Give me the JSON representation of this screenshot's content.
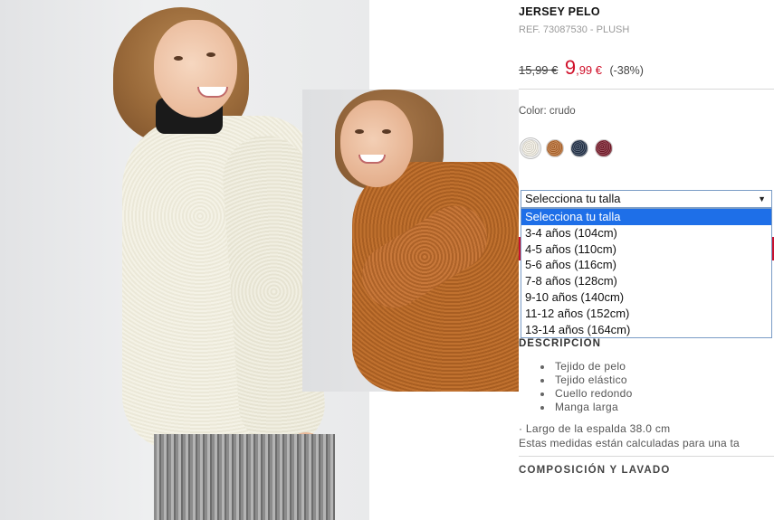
{
  "product": {
    "name": "JERSEY PELO",
    "reference": "REF. 73087530 - PLUSH",
    "old_price": "15,99 €",
    "new_price_int": "9",
    "new_price_rest": ",99 €",
    "discount": "(-38%)"
  },
  "color": {
    "label": "Color: crudo",
    "swatches": [
      {
        "name": "crudo",
        "hex": "#f3efe3",
        "selected": true
      },
      {
        "name": "camel",
        "hex": "#b86a2c",
        "selected": false
      },
      {
        "name": "navy",
        "hex": "#22324a",
        "selected": false
      },
      {
        "name": "burgundy",
        "hex": "#7a1a2a",
        "selected": false
      }
    ]
  },
  "size_select": {
    "selected": "Selecciona tu talla",
    "options": [
      "Selecciona tu talla",
      "3-4 años (104cm)",
      "4-5 años (110cm)",
      "5-6 años (116cm)",
      "7-8 años (128cm)",
      "9-10 años (140cm)",
      "11-12 años (152cm)",
      "13-14 años (164cm)"
    ],
    "highlighted_index": 0
  },
  "description": {
    "heading": "DESCRIPCIÓN",
    "features": [
      "Tejido de pelo",
      "Tejido elástico",
      "Cuello redondo",
      "Manga larga"
    ],
    "length": "· Largo de la espalda 38.0 cm",
    "measures_note": "Estas medidas están calculadas para una ta"
  },
  "composition": {
    "heading": "COMPOSICIÓN Y LAVADO"
  },
  "colors": {
    "sale_red": "#d0102a",
    "highlight_blue": "#1e6fe8"
  }
}
